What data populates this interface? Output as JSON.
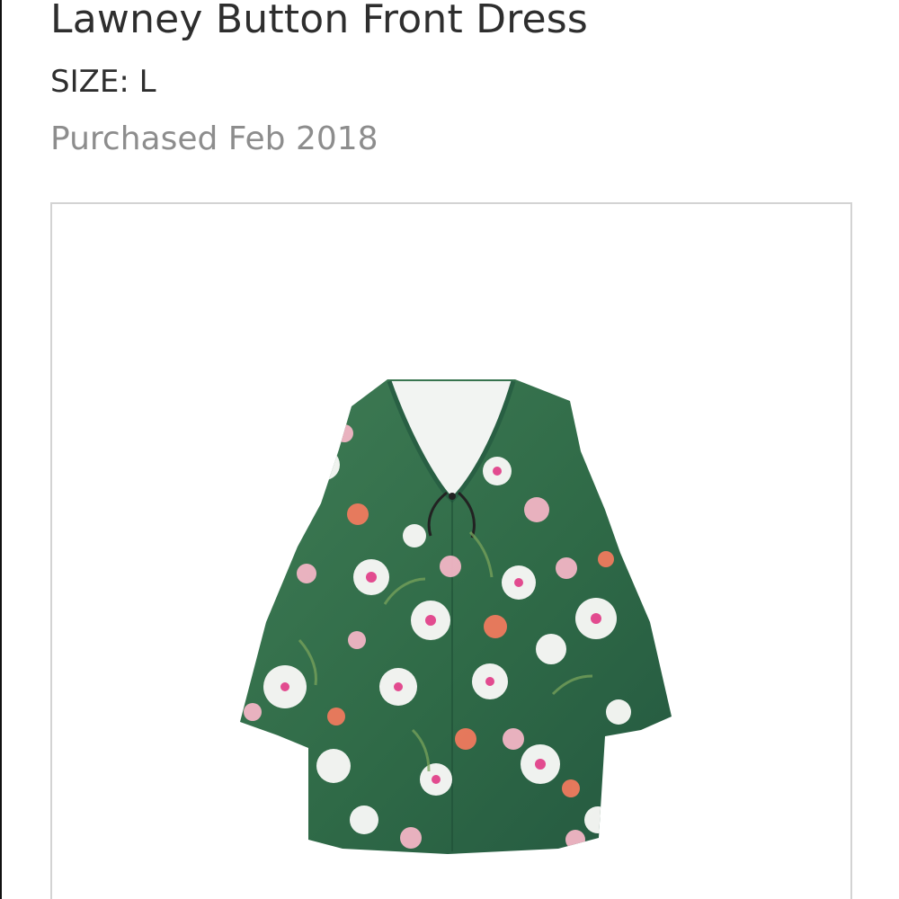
{
  "product": {
    "name": "Lawney Button Front Dress",
    "size_text": "SIZE: L",
    "purchased_text": "Purchased Feb 2018"
  },
  "image": {
    "subject": "floral-dress-image",
    "dress_color": "#2f6a47",
    "flower_colors": [
      "#ffffff",
      "#f3b8c8",
      "#e24b8f",
      "#ef7a5e"
    ]
  }
}
